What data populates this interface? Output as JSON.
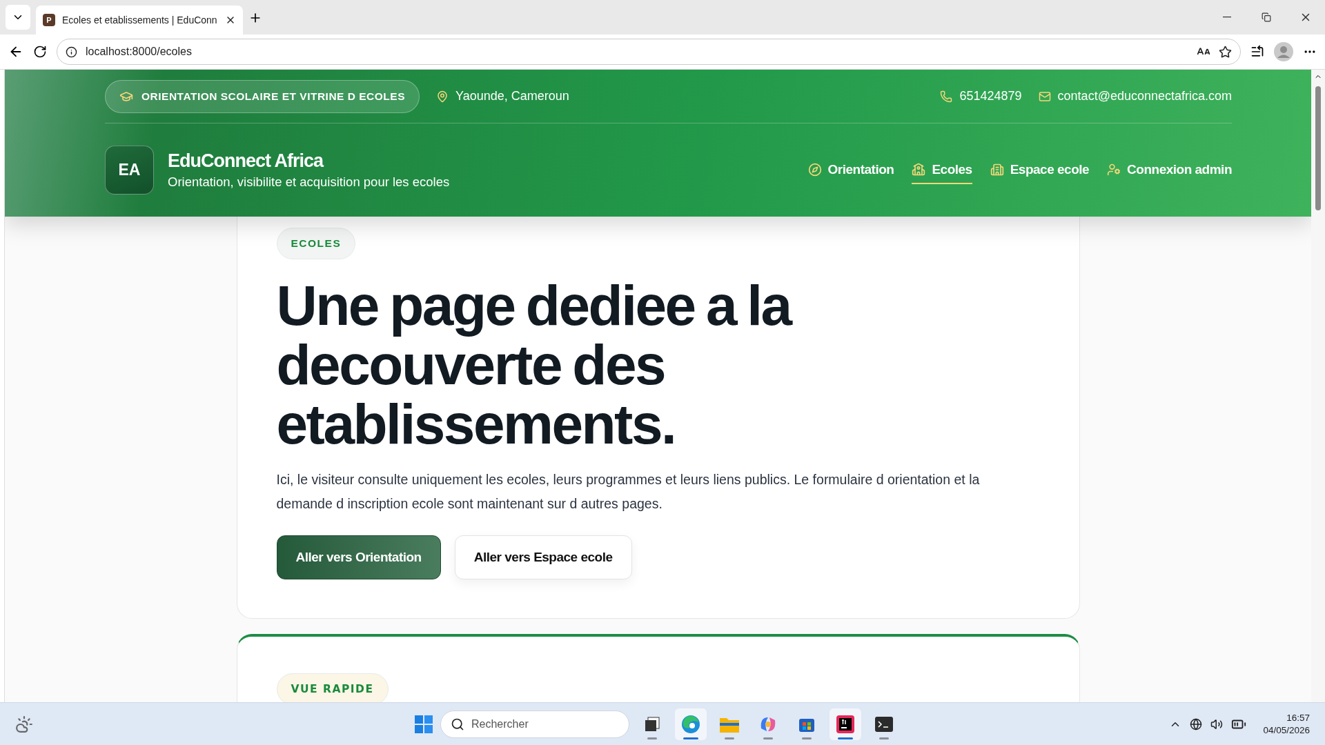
{
  "browser": {
    "tab": {
      "title": "Ecoles et etablissements | EduConn",
      "favicon": "P"
    },
    "url": "localhost:8000/ecoles"
  },
  "topbar": {
    "tagline": "ORIENTATION SCOLAIRE ET VITRINE D ECOLES",
    "location": "Yaounde, Cameroun",
    "phone": "651424879",
    "email": "contact@educonnectafrica.com"
  },
  "brand": {
    "logo": "EA",
    "name": "EduConnect Africa",
    "subtitle": "Orientation, visibilite et acquisition pour les ecoles"
  },
  "nav": [
    {
      "label": "Orientation",
      "selected": false
    },
    {
      "label": "Ecoles",
      "selected": true
    },
    {
      "label": "Espace ecole",
      "selected": false
    },
    {
      "label": "Connexion admin",
      "selected": false
    }
  ],
  "hero": {
    "badge": "ECOLES",
    "headline_lines": [
      "Une page dediee a la",
      "decouverte des",
      "etablissements."
    ],
    "text": "Ici, le visiteur consulte uniquement les ecoles, leurs programmes et leurs liens publics. Le formulaire d orientation et la demande d inscription ecole sont maintenant sur d autres pages.",
    "buttons": [
      {
        "label": "Aller vers Orientation",
        "kind": "primary"
      },
      {
        "label": "Aller vers Espace ecole",
        "kind": "secondary"
      }
    ]
  },
  "overview": {
    "badge": "VUE RAPIDE"
  },
  "taskbar": {
    "search": {
      "placeholder": "Rechercher"
    },
    "apps": [
      {
        "kind": "taskview",
        "selected": false
      },
      {
        "kind": "edge",
        "selected": true
      },
      {
        "kind": "files",
        "selected": false
      },
      {
        "kind": "copilot",
        "selected": false
      },
      {
        "kind": "store",
        "selected": false
      },
      {
        "kind": "ide",
        "selected": true
      },
      {
        "kind": "terminal",
        "selected": false
      }
    ],
    "time": "16:57",
    "date": "04/05/2026"
  }
}
